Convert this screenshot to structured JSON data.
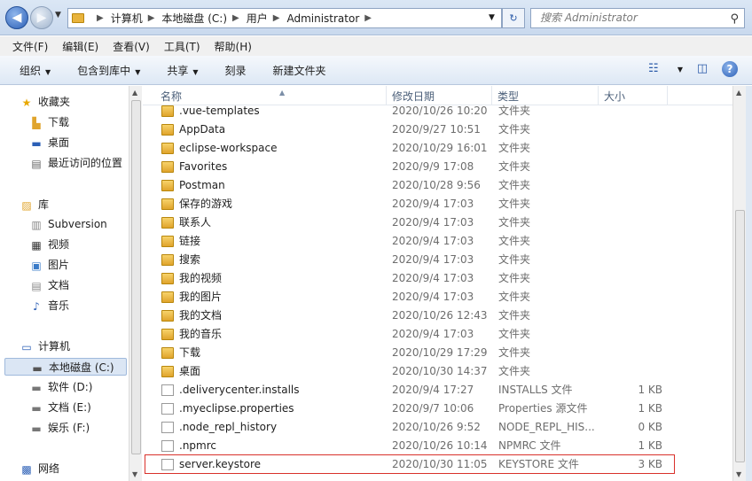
{
  "address": {
    "crumbs": [
      "计算机",
      "本地磁盘 (C:)",
      "用户",
      "Administrator"
    ],
    "search_placeholder": "搜索 Administrator"
  },
  "menu": [
    "文件(F)",
    "编辑(E)",
    "查看(V)",
    "工具(T)",
    "帮助(H)"
  ],
  "toolbar": {
    "organize": "组织",
    "include_library": "包含到库中",
    "share": "共享",
    "burn": "刻录",
    "new_folder": "新建文件夹"
  },
  "nav": {
    "favorites": "收藏夹",
    "downloads": "下载",
    "desktop": "桌面",
    "recent": "最近访问的位置",
    "libraries": "库",
    "subversion": "Subversion",
    "videos": "视频",
    "pictures": "图片",
    "documents": "文档",
    "music": "音乐",
    "computer": "计算机",
    "drive_c": "本地磁盘 (C:)",
    "drive_d": "软件 (D:)",
    "drive_e": "文档 (E:)",
    "drive_f": "娱乐 (F:)",
    "network": "网络"
  },
  "columns": {
    "name": "名称",
    "date": "修改日期",
    "type": "类型",
    "size": "大小"
  },
  "files": [
    {
      "name": ".vue-templates",
      "date": "2020/10/26 10:20",
      "type": "文件夹",
      "size": "",
      "icon": "folder-icon"
    },
    {
      "name": "AppData",
      "date": "2020/9/27 10:51",
      "type": "文件夹",
      "size": "",
      "icon": "folder-icon"
    },
    {
      "name": "eclipse-workspace",
      "date": "2020/10/29 16:01",
      "type": "文件夹",
      "size": "",
      "icon": "folder-icon"
    },
    {
      "name": "Favorites",
      "date": "2020/9/9 17:08",
      "type": "文件夹",
      "size": "",
      "icon": "folder-icon"
    },
    {
      "name": "Postman",
      "date": "2020/10/28 9:56",
      "type": "文件夹",
      "size": "",
      "icon": "folder-icon"
    },
    {
      "name": "保存的游戏",
      "date": "2020/9/4 17:03",
      "type": "文件夹",
      "size": "",
      "icon": "folder-icon"
    },
    {
      "name": "联系人",
      "date": "2020/9/4 17:03",
      "type": "文件夹",
      "size": "",
      "icon": "folder-icon"
    },
    {
      "name": "链接",
      "date": "2020/9/4 17:03",
      "type": "文件夹",
      "size": "",
      "icon": "folder-icon"
    },
    {
      "name": "搜索",
      "date": "2020/9/4 17:03",
      "type": "文件夹",
      "size": "",
      "icon": "folder-icon"
    },
    {
      "name": "我的视频",
      "date": "2020/9/4 17:03",
      "type": "文件夹",
      "size": "",
      "icon": "folder-icon"
    },
    {
      "name": "我的图片",
      "date": "2020/9/4 17:03",
      "type": "文件夹",
      "size": "",
      "icon": "folder-icon"
    },
    {
      "name": "我的文档",
      "date": "2020/10/26 12:43",
      "type": "文件夹",
      "size": "",
      "icon": "folder-icon"
    },
    {
      "name": "我的音乐",
      "date": "2020/9/4 17:03",
      "type": "文件夹",
      "size": "",
      "icon": "folder-icon"
    },
    {
      "name": "下载",
      "date": "2020/10/29 17:29",
      "type": "文件夹",
      "size": "",
      "icon": "folder-icon"
    },
    {
      "name": "桌面",
      "date": "2020/10/30 14:37",
      "type": "文件夹",
      "size": "",
      "icon": "folder-icon"
    },
    {
      "name": ".deliverycenter.installs",
      "date": "2020/9/4 17:27",
      "type": "INSTALLS 文件",
      "size": "1 KB",
      "icon": "file-icon"
    },
    {
      "name": ".myeclipse.properties",
      "date": "2020/9/7 10:06",
      "type": "Properties 源文件",
      "size": "1 KB",
      "icon": "file-icon"
    },
    {
      "name": ".node_repl_history",
      "date": "2020/10/26 9:52",
      "type": "NODE_REPL_HIS...",
      "size": "0 KB",
      "icon": "file-icon"
    },
    {
      "name": ".npmrc",
      "date": "2020/10/26 10:14",
      "type": "NPMRC 文件",
      "size": "1 KB",
      "icon": "file-icon"
    },
    {
      "name": "server.keystore",
      "date": "2020/10/30 11:05",
      "type": "KEYSTORE 文件",
      "size": "3 KB",
      "icon": "file-icon"
    }
  ]
}
